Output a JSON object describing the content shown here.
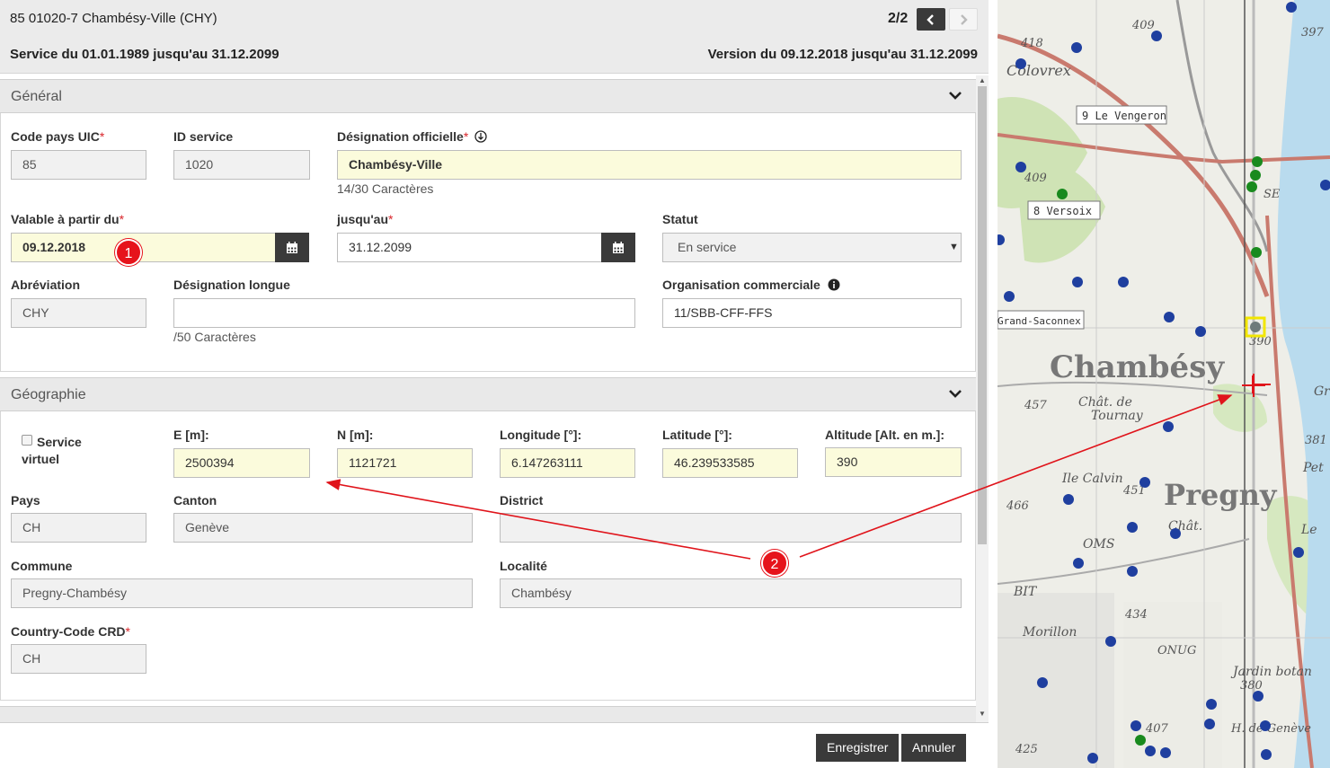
{
  "header": {
    "title": "85 01020-7 Chambésy-Ville (CHY)",
    "pager": "2/2",
    "service": "Service du 01.01.1989 jusqu'au 31.12.2099",
    "version": "Version du 09.12.2018 jusqu'au 31.12.2099"
  },
  "general": {
    "section_label": "Général",
    "code_pays_label": "Code pays UIC",
    "code_pays_value": "85",
    "id_service_label": "ID service",
    "id_service_value": "1020",
    "designation_label": "Désignation officielle",
    "designation_value": "Chambésy-Ville",
    "designation_count": "14/30 Caractères",
    "valable_label": "Valable à partir du",
    "valable_value": "09.12.2018",
    "jusquau_label": "jusqu'au",
    "jusquau_value": "31.12.2099",
    "statut_label": "Statut",
    "statut_value": "En service",
    "abreviation_label": "Abréviation",
    "abreviation_value": "CHY",
    "designation_longue_label": "Désignation longue",
    "designation_longue_value": "",
    "designation_longue_count": "/50 Caractères",
    "organisation_label": "Organisation commerciale",
    "organisation_value": "11/SBB-CFF-FFS"
  },
  "geographie": {
    "section_label": "Géographie",
    "service_virtuel_label_1": "Service",
    "service_virtuel_label_2": "virtuel",
    "e_label": "E [m]:",
    "e_value": "2500394",
    "n_label": "N [m]:",
    "n_value": "1121721",
    "longitude_label": "Longitude [°]:",
    "longitude_value": "6.147263111",
    "latitude_label": "Latitude [°]:",
    "latitude_value": "46.239533585",
    "altitude_label": "Altitude [Alt. en m.]:",
    "altitude_value": "390",
    "pays_label": "Pays",
    "pays_value": "CH",
    "canton_label": "Canton",
    "canton_value": "Genève",
    "district_label": "District",
    "district_value": "",
    "commune_label": "Commune",
    "commune_value": "Pregny-Chambésy",
    "localite_label": "Localité",
    "localite_value": "Chambésy",
    "country_code_label": "Country-Code CRD",
    "country_code_value": "CH"
  },
  "annotations": {
    "badge1": "1",
    "badge2": "2"
  },
  "footer": {
    "save_label": "Enregistrer",
    "cancel_label": "Annuler"
  },
  "map": {
    "labels": {
      "colovrex": "Colovrex",
      "le_vengeron": "9 Le Vengeron",
      "versoix": "8 Versoix",
      "grand_saconnex": "Grand-Saconnex",
      "chambesy": "Chambésy",
      "chat_de_tournay_1": "Chât. de",
      "chat_de_tournay_2": "Tournay",
      "pregny": "Pregny",
      "ile_calvin": "Ile Calvin",
      "chat": "Chât.",
      "oms": "OMS",
      "bit": "BIT",
      "morillon": "Morillon",
      "onug": "ONUG",
      "jardin_botan": "Jardin botan",
      "h_de_geneve": "H. de Genève",
      "le": "Le",
      "pet": "Pet",
      "gr": "Gr",
      "se": "SE",
      "n418": "418",
      "n409a": "409",
      "n397": "397",
      "n409b": "409",
      "n390": "390",
      "n457": "457",
      "n451": "451",
      "n466": "466",
      "n381": "381",
      "n434": "434",
      "n380": "380",
      "n425": "425",
      "n407": "407"
    },
    "colors": {
      "stop_blue": "#1f3f9f",
      "stop_green": "#198a1e",
      "highlight": "#f2e600",
      "crosshair": "#e0141b"
    }
  }
}
